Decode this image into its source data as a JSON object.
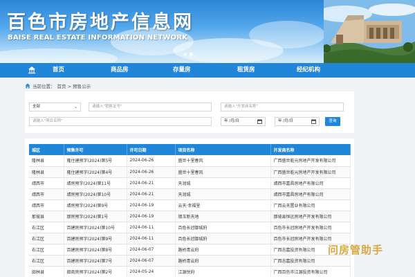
{
  "banner": {
    "title": "百色市房地产信息网",
    "subtitle": "BAISE REAL ESTATE INFORMATION NETWORK"
  },
  "nav": {
    "items": [
      {
        "label": "首页",
        "icon": "home-icon"
      },
      {
        "label": "商品房"
      },
      {
        "label": "存量房"
      },
      {
        "label": "租赁房"
      },
      {
        "label": "经纪机构"
      }
    ]
  },
  "breadcrumb": {
    "prefix": "当前位置：",
    "path": "首页 > 预售公示",
    "icon": "home-icon"
  },
  "filters": {
    "area_select": "全部",
    "permit_placeholder": "请输入\"销售证号\"",
    "developer_placeholder": "请输入\"开发商名称\"",
    "project_placeholder": "请输入\"项目名称\"",
    "date_start": "年 /月/日",
    "date_end": "年 /月/日",
    "query_label": "查询"
  },
  "table": {
    "headers": [
      "城区",
      "预售许可",
      "许可日期",
      "项目名称",
      "开发商名称"
    ],
    "rows": [
      [
        "隆林县",
        "隆住建预字(2024)第5号",
        "2024-06-26",
        "盛世十里春风",
        "广西盛世乾元房地产开发有限公司"
      ],
      [
        "隆林县",
        "隆住建预字(2024)第4号",
        "2024-06-26",
        "盛世十里春风",
        "广西盛世乾元房地产开发有限公司"
      ],
      [
        "靖西市",
        "靖房预字(2024)第11号",
        "2024-06-21",
        "天润城",
        "靖西市嘉昌房地产有限公司"
      ],
      [
        "靖西市",
        "靖房预字(2024)第10号",
        "2024-06-21",
        "天润城",
        "靖西市嘉昌房地产有限公司"
      ],
      [
        "靖西市",
        "靖房预字(2024)第9号",
        "2024-06-19",
        "云天·幸福里",
        "广西云天置业有限公司"
      ],
      [
        "那坡县",
        "那房预字(2024)第1号",
        "2024-06-19",
        "镇玉新天地",
        "那坡县恒远房地产开发有限公司"
      ],
      [
        "右江区",
        "百建房预字(2024)第10号",
        "2024-06-11",
        "百色长冠御城府",
        "百色市长冠房地产开发有限公司"
      ],
      [
        "右江区",
        "百建房预字(2024)第9号",
        "2024-06-11",
        "百色长冠御城府",
        "百色市长冠房地产开发有限公司"
      ],
      [
        "右江区",
        "百建房预字(2024)第8号",
        "2024-06-07",
        "路桥青云府",
        "广西吉嘉投资有限公司"
      ],
      [
        "右江区",
        "百建房预字(2024)第7号",
        "2024-06-07",
        "路桥青云府",
        "广西吉嘉投资有限公司"
      ],
      [
        "田林县",
        "田商房预字(2024)第2号",
        "2024-05-24",
        "江源悦府",
        "广西百色市江源投资有限公司"
      ]
    ]
  },
  "watermark": {
    "text": "问房管助手"
  },
  "colors": {
    "nav_blue": "#1f86d9",
    "header_blue": "#1f86d9",
    "watermark_gold": "#d5a028"
  }
}
